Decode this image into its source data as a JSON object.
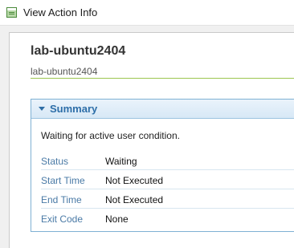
{
  "window": {
    "title": "View Action Info",
    "icon": "app-window-icon"
  },
  "host": {
    "name": "lab-ubuntu2404",
    "subtitle": "lab-ubuntu2404"
  },
  "summary": {
    "title": "Summary",
    "message": "Waiting for active user condition.",
    "rows": [
      {
        "label": "Status",
        "value": "Waiting"
      },
      {
        "label": "Start Time",
        "value": "Not Executed"
      },
      {
        "label": "End Time",
        "value": "Not Executed"
      },
      {
        "label": "Exit Code",
        "value": "None"
      }
    ]
  },
  "colors": {
    "accent_line": "#9cc650",
    "panel_border": "#7fb1d4",
    "panel_title": "#2d6ea8",
    "label_text": "#4a7aa6"
  }
}
